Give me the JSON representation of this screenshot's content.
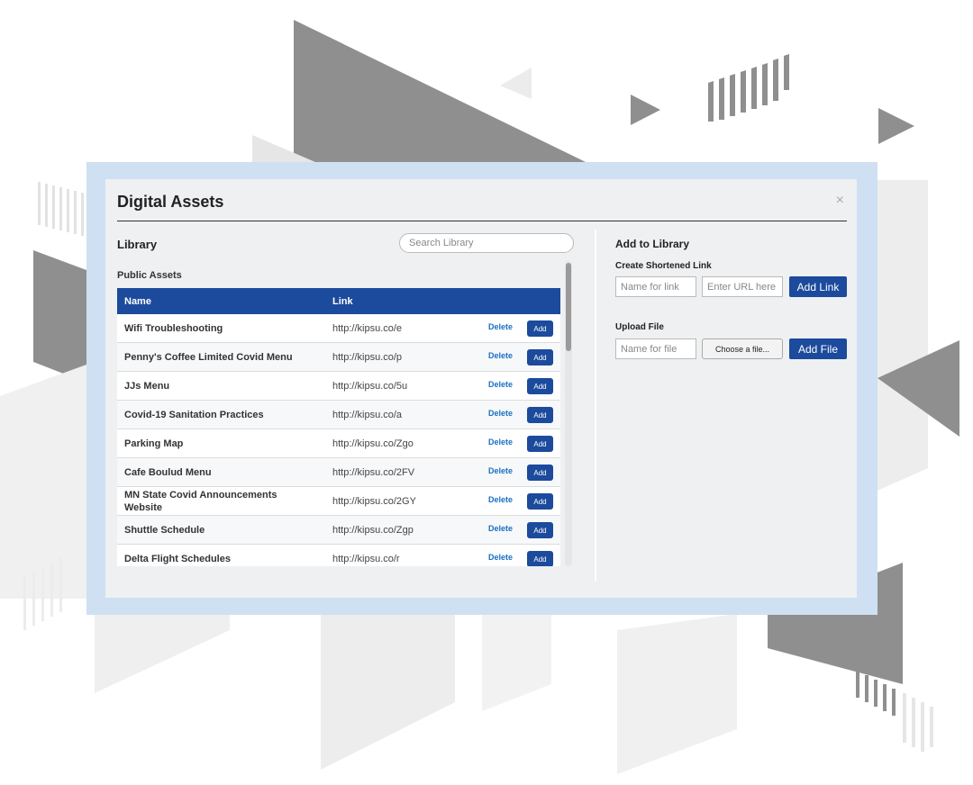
{
  "modal": {
    "title": "Digital Assets",
    "close": "×"
  },
  "library": {
    "label": "Library",
    "search_placeholder": "Search Library",
    "public_label": "Public Assets",
    "columns": {
      "name": "Name",
      "link": "Link"
    },
    "delete_label": "Delete",
    "add_label": "Add",
    "rows": [
      {
        "name": "Wifi Troubleshooting",
        "link": "http://kipsu.co/e"
      },
      {
        "name": "Penny's Coffee Limited Covid Menu",
        "link": "http://kipsu.co/p"
      },
      {
        "name": "JJs Menu",
        "link": "http://kipsu.co/5u"
      },
      {
        "name": "Covid-19 Sanitation Practices",
        "link": "http://kipsu.co/a"
      },
      {
        "name": "Parking Map",
        "link": "http://kipsu.co/Zgo"
      },
      {
        "name": "Cafe Boulud Menu",
        "link": "http://kipsu.co/2FV"
      },
      {
        "name": "MN State Covid Announcements Website",
        "link": "http://kipsu.co/2GY"
      },
      {
        "name": "Shuttle Schedule",
        "link": "http://kipsu.co/Zgp"
      },
      {
        "name": "Delta Flight Schedules",
        "link": "http://kipsu.co/r"
      }
    ]
  },
  "add_panel": {
    "title": "Add to Library",
    "short_link_label": "Create Shortened Link",
    "link_name_placeholder": "Name for link",
    "url_placeholder": "Enter URL here",
    "add_link_button": "Add Link",
    "upload_label": "Upload File",
    "file_name_placeholder": "Name for file",
    "choose_file_button": "Choose a file...",
    "add_file_button": "Add File"
  },
  "colors": {
    "header_blue": "#1c4a9c",
    "delete_blue": "#1a6fc4",
    "frame_blue": "#cfe0f2"
  }
}
